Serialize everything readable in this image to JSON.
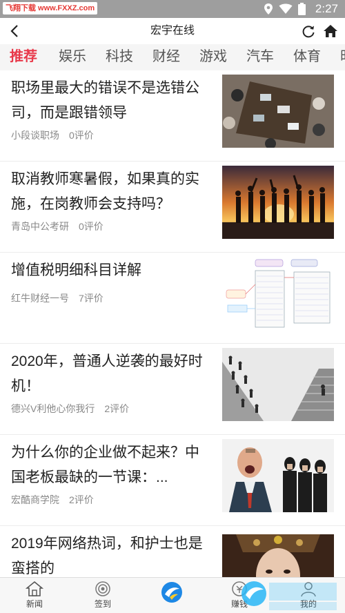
{
  "status_bar": {
    "watermark": "飞翔下载 www.FXXZ.com",
    "time": "2:27"
  },
  "header": {
    "title": "宏宇在线"
  },
  "tabs": [
    {
      "label": "推荐",
      "active": true
    },
    {
      "label": "娱乐",
      "active": false
    },
    {
      "label": "科技",
      "active": false
    },
    {
      "label": "财经",
      "active": false
    },
    {
      "label": "游戏",
      "active": false
    },
    {
      "label": "汽车",
      "active": false
    },
    {
      "label": "体育",
      "active": false
    },
    {
      "label": "时",
      "active": false
    }
  ],
  "articles": [
    {
      "title": "职场里最大的错误不是选错公司，而是跟错领导",
      "source": "小段谈职场",
      "comments": "0评价",
      "image": "meeting-table"
    },
    {
      "title": "取消教师寒暑假，如果真的实施，在岗教师会支持吗？",
      "source": "青岛中公考研",
      "comments": "0评价",
      "image": "sunset-silhouettes"
    },
    {
      "title": "增值税明细科目详解",
      "source": "红牛财经一号",
      "comments": "7评价",
      "image": "tax-diagram"
    },
    {
      "title": "2020年，普通人逆袭的最好时机！",
      "source": "德兴V利他心你我行",
      "comments": "2评价",
      "image": "stairs-runners"
    },
    {
      "title": "为什么你的企业做不起来？中国老板最缺的一节课：...",
      "source": "宏酷商学院",
      "comments": "2评价",
      "image": "shouting-boss"
    },
    {
      "title": "2019年网络热词，和护士也是蛮搭的",
      "source": "",
      "comments": "",
      "image": "costume-portrait"
    }
  ],
  "bottom_nav": [
    {
      "label": "新闻",
      "icon": "home-icon"
    },
    {
      "label": "签到",
      "icon": "target-icon"
    },
    {
      "label": "",
      "icon": "app-logo-icon"
    },
    {
      "label": "赚钱",
      "icon": "coin-icon"
    },
    {
      "label": "我的",
      "icon": "user-icon"
    }
  ],
  "colors": {
    "accent": "#e8394a",
    "status_bar": "#9e9e9e",
    "tab_bg": "#f5f5f5",
    "meta_text": "#888888"
  }
}
